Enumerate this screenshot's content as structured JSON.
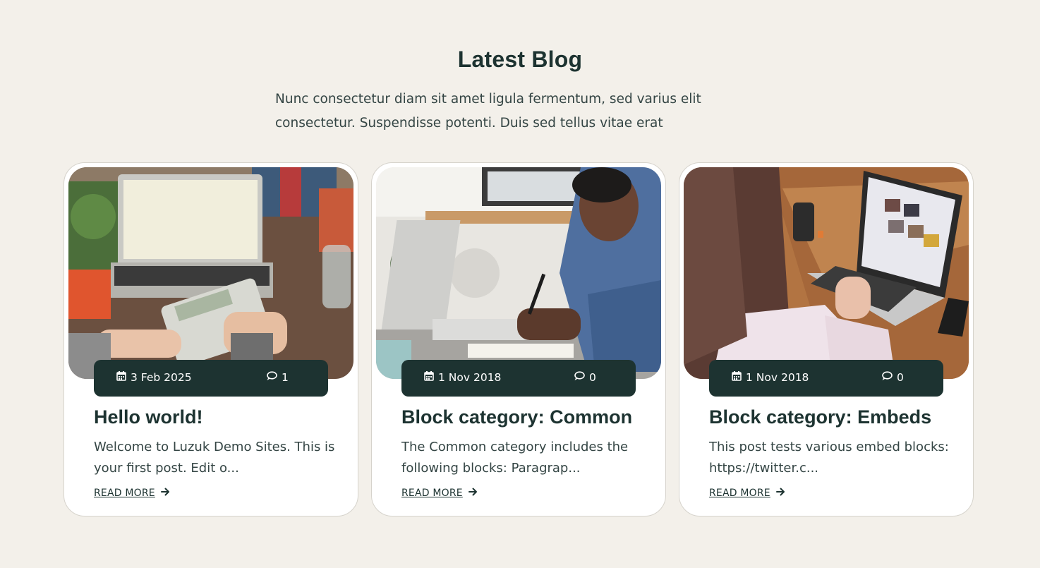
{
  "section": {
    "title": "Latest Blog",
    "description": "Nunc consectetur diam sit amet ligula fermentum, sed varius elit consectetur. Suspendisse potenti. Duis sed tellus vitae erat"
  },
  "posts": [
    {
      "date": "3 Feb 2025",
      "comments": "1",
      "title": "Hello world!",
      "excerpt": "Welcome to Luzuk Demo Sites. This is your first post. Edit o...",
      "read_more": "READ MORE",
      "image": "laptop-calculator-desk"
    },
    {
      "date": "1 Nov 2018",
      "comments": "0",
      "title": "Block category: Common",
      "excerpt": "The Common category includes the following blocks: Paragrap...",
      "read_more": "READ MORE",
      "image": "man-writing-notebook"
    },
    {
      "date": "1 Nov 2018",
      "comments": "0",
      "title": "Block category: Embeds",
      "excerpt": "This post tests various embed blocks: https://twitter.c...",
      "read_more": "READ MORE",
      "image": "woman-laptop-table"
    }
  ],
  "colors": {
    "background": "#f3f0ea",
    "accent_dark": "#1d3331",
    "card": "#ffffff"
  },
  "icons": {
    "date": "calendar-icon",
    "comments": "comment-icon",
    "read_more": "arrow-right-icon"
  }
}
